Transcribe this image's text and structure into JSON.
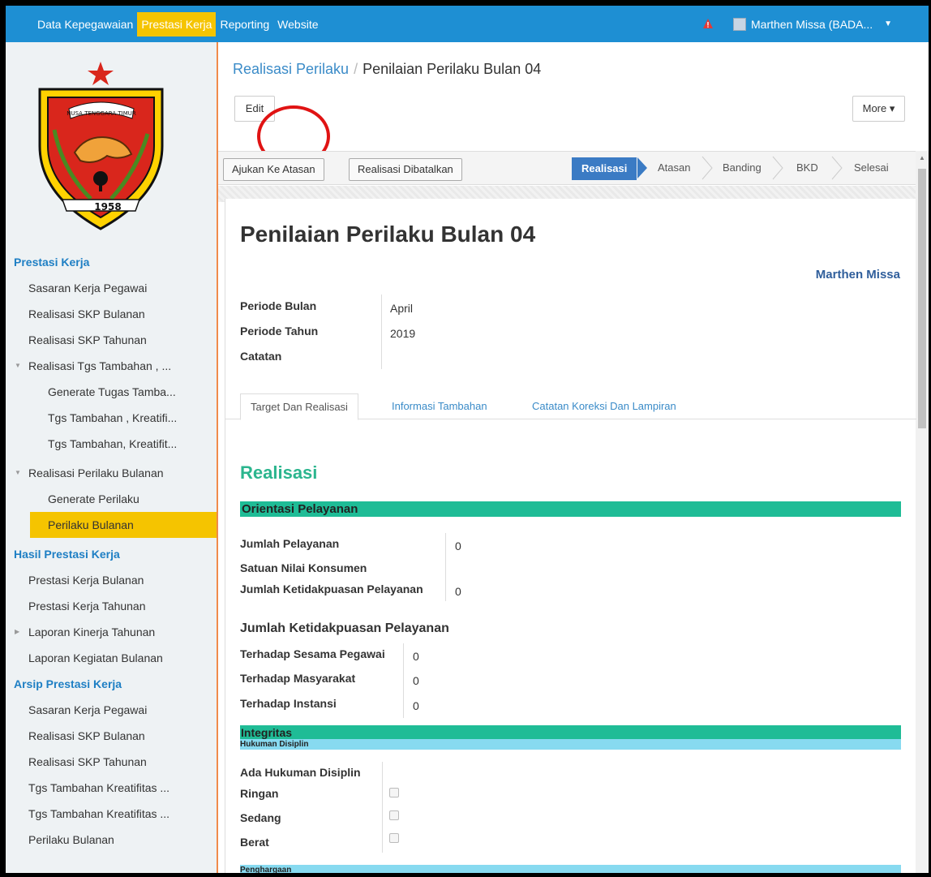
{
  "topnav": {
    "menu": [
      "Data Kepegawaian",
      "Prestasi Kerja",
      "Reporting",
      "Website"
    ],
    "user": "Marthen Missa (BADA..."
  },
  "logo": {
    "banner": "NUSA TENGGARA TIMUR",
    "year": "1958"
  },
  "sidebar": {
    "sec1": "Prestasi Kerja",
    "s1": [
      "Sasaran Kerja Pegawai",
      "Realisasi SKP Bulanan",
      "Realisasi SKP Tahunan",
      "Realisasi Tgs Tambahan , ...",
      "Generate Tugas Tamba...",
      "Tgs Tambahan , Kreatifi...",
      "Tgs Tambahan, Kreatifit...",
      "Realisasi Perilaku Bulanan",
      "Generate Perilaku",
      "Perilaku Bulanan"
    ],
    "sec2": "Hasil Prestasi Kerja",
    "s2": [
      "Prestasi Kerja Bulanan",
      "Prestasi Kerja Tahunan",
      "Laporan Kinerja Tahunan",
      "Laporan Kegiatan Bulanan"
    ],
    "sec3": "Arsip Prestasi Kerja",
    "s3": [
      "Sasaran Kerja Pegawai",
      "Realisasi SKP Bulanan",
      "Realisasi SKP Tahunan",
      "Tgs Tambahan Kreatifitas ...",
      "Tgs Tambahan Kreatifitas ...",
      "Perilaku Bulanan"
    ]
  },
  "breadcrumb": {
    "parent": "Realisasi Perilaku",
    "current": "Penilaian Perilaku Bulan 04"
  },
  "buttons": {
    "edit": "Edit",
    "more": "More ▾",
    "ajukan": "Ajukan Ke Atasan",
    "batal": "Realisasi Dibatalkan"
  },
  "stages": [
    "Realisasi",
    "Atasan",
    "Banding",
    "BKD",
    "Selesai"
  ],
  "form": {
    "title": "Penilaian Perilaku Bulan 04",
    "owner": "Marthen Missa",
    "periode_bulan_label": "Periode Bulan",
    "periode_bulan": "April",
    "periode_tahun_label": "Periode Tahun",
    "periode_tahun": "2019",
    "catatan_label": "Catatan"
  },
  "tabs": [
    "Target Dan Realisasi",
    "Informasi Tambahan",
    "Catatan Koreksi Dan Lampiran"
  ],
  "realisasi": {
    "title": "Realisasi",
    "orientasi": "Orientasi Pelayanan",
    "jumlah_pelayanan_label": "Jumlah Pelayanan",
    "jumlah_pelayanan": "0",
    "satuan_label": "Satuan Nilai Konsumen",
    "ketidakpuasan_label": "Jumlah Ketidakpuasan Pelayanan",
    "ketidakpuasan": "0",
    "sub_heading": "Jumlah Ketidakpuasan Pelayanan",
    "sesama_label": "Terhadap Sesama Pegawai",
    "sesama": "0",
    "masyarakat_label": "Terhadap Masyarakat",
    "masyarakat": "0",
    "instansi_label": "Terhadap Instansi",
    "instansi": "0",
    "integritas": "Integritas",
    "hukuman": "Hukuman Disiplin",
    "ada_hukuman_label": "Ada Hukuman Disiplin",
    "ringan_label": "Ringan",
    "sedang_label": "Sedang",
    "berat_label": "Berat",
    "penghargaan": "Penghargaan"
  },
  "colors": {
    "nav": "#1e8fd3",
    "highlight": "#f5c400",
    "green": "#1fbc96",
    "blue_bar": "#87daf0",
    "stage": "#3b7bc4"
  }
}
